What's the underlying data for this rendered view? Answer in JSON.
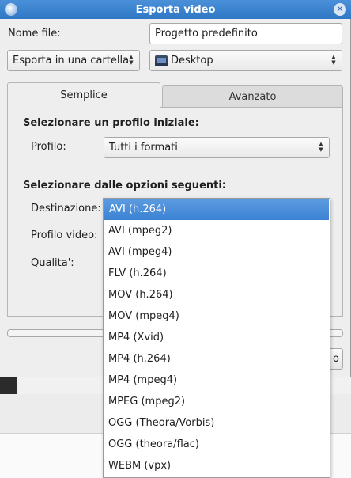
{
  "window": {
    "title": "Esporta video"
  },
  "file_name": {
    "label": "Nome file:",
    "value": "Progetto predefinito"
  },
  "export_mode": {
    "selected": "Esporta in una cartella"
  },
  "folder": {
    "selected": "Desktop",
    "icon": "folder-icon"
  },
  "tabs": {
    "simple": "Semplice",
    "advanced": "Avanzato"
  },
  "initial_profile": {
    "heading": "Selezionare un profilo iniziale:",
    "profile_label": "Profilo:",
    "profile_value": "Tutti i formati"
  },
  "options": {
    "heading": "Selezionare dalle opzioni seguenti:",
    "destination_label": "Destinazione:",
    "video_profile_label": "Profilo video:",
    "quality_label": "Qualita':"
  },
  "partial_button": {
    "label": "o"
  },
  "dropdown": {
    "selected_index": 0,
    "items": [
      "AVI (h.264)",
      "AVI (mpeg2)",
      "AVI (mpeg4)",
      "FLV (h.264)",
      "MOV (h.264)",
      "MOV (mpeg4)",
      "MP4 (Xvid)",
      "MP4 (h.264)",
      "MP4 (mpeg4)",
      "MPEG (mpeg2)",
      "OGG (Theora/Vorbis)",
      "OGG (theora/flac)",
      "WEBM (vpx)"
    ]
  },
  "colors": {
    "titlebar": "#3a83cf",
    "selection": "#4a8ed9"
  }
}
